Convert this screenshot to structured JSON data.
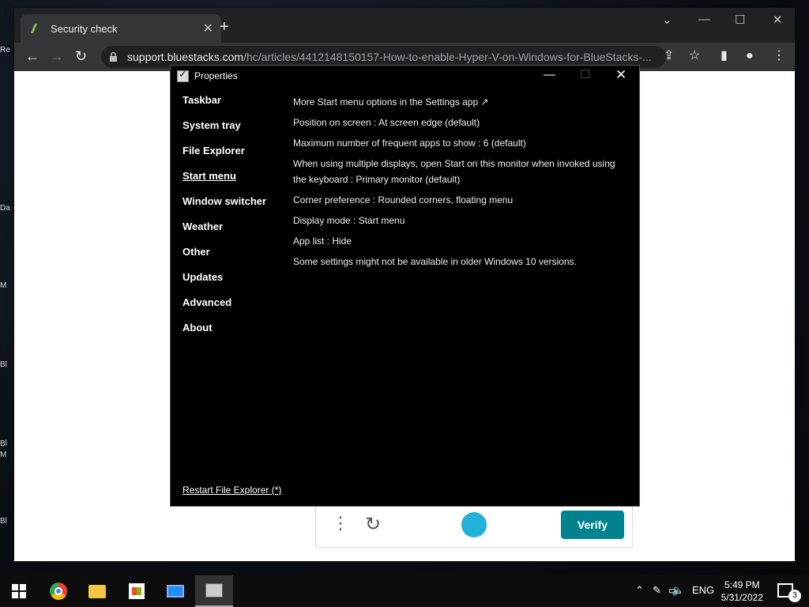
{
  "desktop": {
    "fragments": [
      "Re",
      "Da",
      "M",
      "Bl",
      "Bl",
      "M",
      "Bl"
    ]
  },
  "browser": {
    "tab_title": "Security check",
    "url_host": "support.bluestacks.com",
    "url_path": "/hc/articles/4412148150157-How-to-enable-Hyper-V-on-Windows-for-BlueStacks-..."
  },
  "captcha": {
    "verify_label": "Verify"
  },
  "properties": {
    "title": "Properties",
    "sidebar": [
      {
        "label": "Taskbar"
      },
      {
        "label": "System tray"
      },
      {
        "label": "File Explorer"
      },
      {
        "label": "Start menu",
        "active": true
      },
      {
        "label": "Window switcher"
      },
      {
        "label": "Weather"
      },
      {
        "label": "Other"
      },
      {
        "label": "Updates"
      },
      {
        "label": "Advanced"
      },
      {
        "label": "About"
      }
    ],
    "options": [
      "More Start menu options in the Settings app ↗",
      "Position on screen : At screen edge (default)",
      "Maximum number of frequent apps to show : 6 (default)",
      "When using multiple displays, open Start on this monitor when invoked using the keyboard : Primary monitor (default)",
      "Corner preference : Rounded corners, floating menu",
      "Display mode : Start menu",
      "App list : Hide",
      "Some settings might not be available in older Windows 10 versions."
    ],
    "restart_link": "Restart File Explorer (*)"
  },
  "taskbar": {
    "language": "ENG",
    "time": "5:49 PM",
    "date": "5/31/2022",
    "notification_count": "3"
  },
  "icons": [
    "search-icon",
    "lock-icon",
    "star-icon",
    "share-icon",
    "profile-icon",
    "menu-icon"
  ]
}
